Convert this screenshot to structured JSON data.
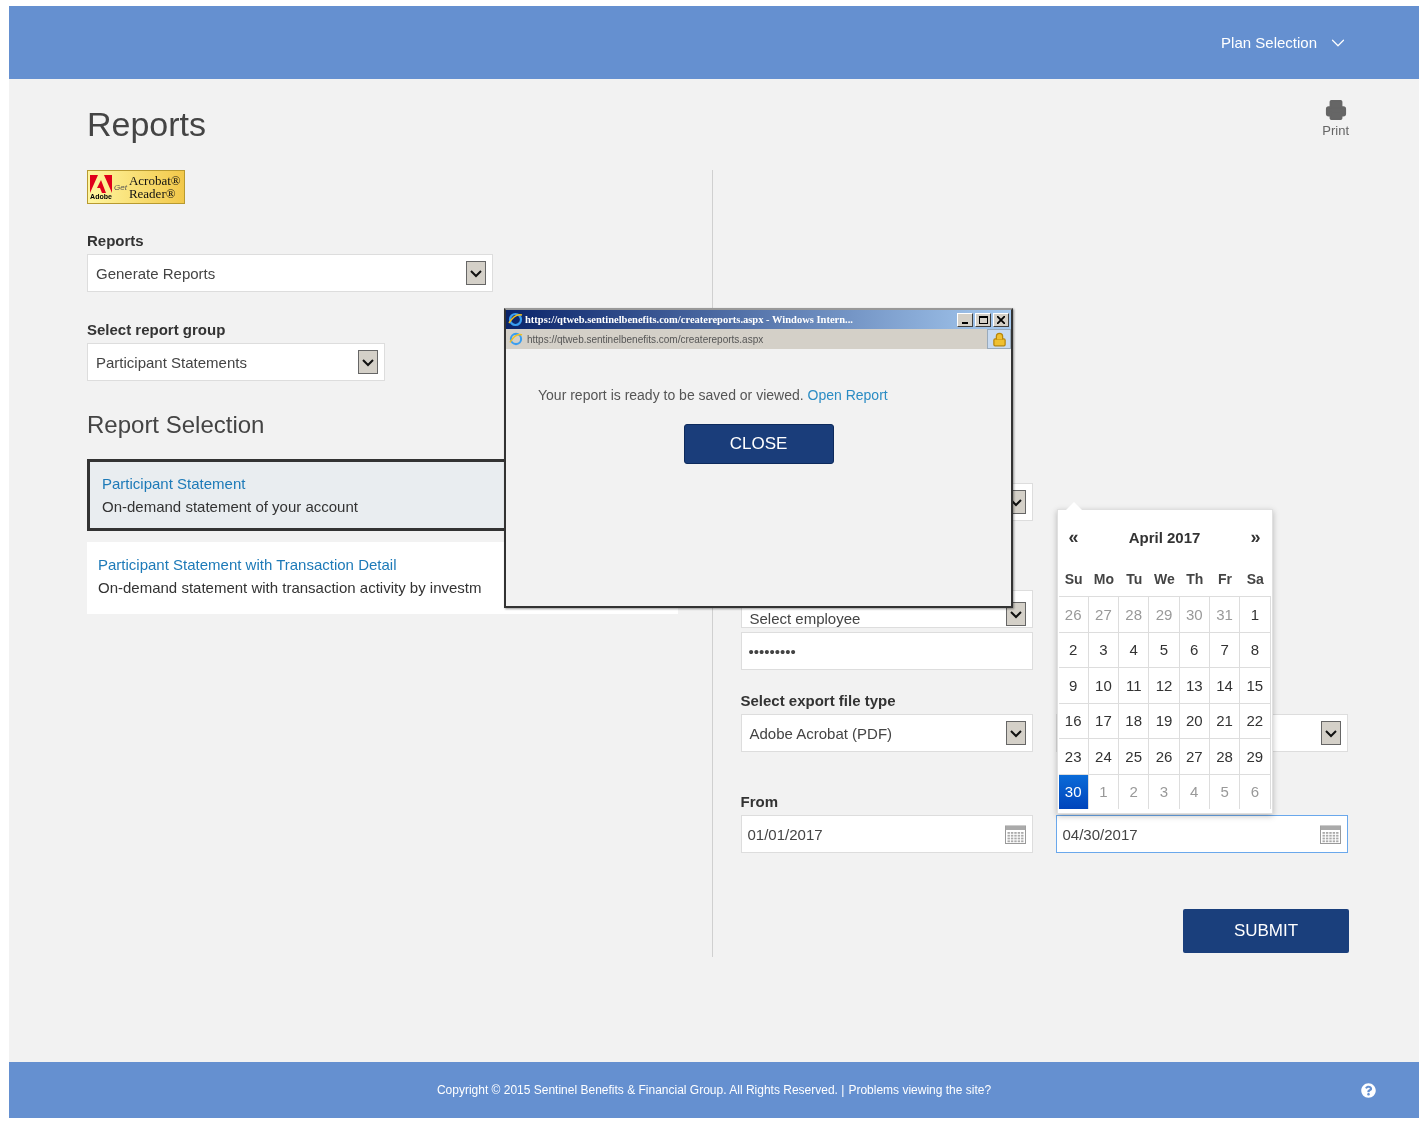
{
  "header": {
    "plan_selection": "Plan Selection"
  },
  "page": {
    "title": "Reports",
    "print_label": "Print"
  },
  "acrobat_badge": {
    "brand": "Adobe",
    "get": "Get",
    "line1": "Acrobat®",
    "line2": "Reader®"
  },
  "reports_field": {
    "label": "Reports",
    "value": "Generate Reports"
  },
  "report_group_field": {
    "label": "Select report group",
    "value": "Participant Statements"
  },
  "report_selection": {
    "heading": "Report Selection",
    "items": [
      {
        "title": "Participant Statement",
        "description": "On-demand statement of your account",
        "selected": true
      },
      {
        "title": "Participant Statement with Transaction Detail",
        "description": "On-demand statement with transaction activity by investm",
        "selected": false
      }
    ]
  },
  "right_form": {
    "employee_select": {
      "value": "Select employee"
    },
    "password": {
      "value": "•••••••••"
    },
    "export_type": {
      "label": "Select export file type",
      "value": "Adobe Acrobat (PDF)"
    },
    "from": {
      "label": "From",
      "value": "01/01/2017"
    },
    "to": {
      "value": "04/30/2017",
      "focused": true
    },
    "submit": "SUBMIT"
  },
  "datepicker": {
    "prev": "«",
    "month_label": "April 2017",
    "next": "»",
    "weekdays": [
      "Su",
      "Mo",
      "Tu",
      "We",
      "Th",
      "Fr",
      "Sa"
    ],
    "weeks": [
      [
        {
          "day": "26",
          "outside": true,
          "selected": false
        },
        {
          "day": "27",
          "outside": true,
          "selected": false
        },
        {
          "day": "28",
          "outside": true,
          "selected": false
        },
        {
          "day": "29",
          "outside": true,
          "selected": false
        },
        {
          "day": "30",
          "outside": true,
          "selected": false
        },
        {
          "day": "31",
          "outside": true,
          "selected": false
        },
        {
          "day": "1",
          "outside": false,
          "selected": false
        }
      ],
      [
        {
          "day": "2",
          "outside": false,
          "selected": false
        },
        {
          "day": "3",
          "outside": false,
          "selected": false
        },
        {
          "day": "4",
          "outside": false,
          "selected": false
        },
        {
          "day": "5",
          "outside": false,
          "selected": false
        },
        {
          "day": "6",
          "outside": false,
          "selected": false
        },
        {
          "day": "7",
          "outside": false,
          "selected": false
        },
        {
          "day": "8",
          "outside": false,
          "selected": false
        }
      ],
      [
        {
          "day": "9",
          "outside": false,
          "selected": false
        },
        {
          "day": "10",
          "outside": false,
          "selected": false
        },
        {
          "day": "11",
          "outside": false,
          "selected": false
        },
        {
          "day": "12",
          "outside": false,
          "selected": false
        },
        {
          "day": "13",
          "outside": false,
          "selected": false
        },
        {
          "day": "14",
          "outside": false,
          "selected": false
        },
        {
          "day": "15",
          "outside": false,
          "selected": false
        }
      ],
      [
        {
          "day": "16",
          "outside": false,
          "selected": false
        },
        {
          "day": "17",
          "outside": false,
          "selected": false
        },
        {
          "day": "18",
          "outside": false,
          "selected": false
        },
        {
          "day": "19",
          "outside": false,
          "selected": false
        },
        {
          "day": "20",
          "outside": false,
          "selected": false
        },
        {
          "day": "21",
          "outside": false,
          "selected": false
        },
        {
          "day": "22",
          "outside": false,
          "selected": false
        }
      ],
      [
        {
          "day": "23",
          "outside": false,
          "selected": false
        },
        {
          "day": "24",
          "outside": false,
          "selected": false
        },
        {
          "day": "25",
          "outside": false,
          "selected": false
        },
        {
          "day": "26",
          "outside": false,
          "selected": false
        },
        {
          "day": "27",
          "outside": false,
          "selected": false
        },
        {
          "day": "28",
          "outside": false,
          "selected": false
        },
        {
          "day": "29",
          "outside": false,
          "selected": false
        }
      ],
      [
        {
          "day": "30",
          "outside": false,
          "selected": true
        },
        {
          "day": "1",
          "outside": true,
          "selected": false
        },
        {
          "day": "2",
          "outside": true,
          "selected": false
        },
        {
          "day": "3",
          "outside": true,
          "selected": false
        },
        {
          "day": "4",
          "outside": true,
          "selected": false
        },
        {
          "day": "5",
          "outside": true,
          "selected": false
        },
        {
          "day": "6",
          "outside": true,
          "selected": false
        }
      ]
    ]
  },
  "popup": {
    "title": "https://qtweb.sentinelbenefits.com/createreports.aspx - Windows Intern...",
    "address": "https://qtweb.sentinelbenefits.com/createreports.aspx",
    "message": "Your report is ready to be saved or viewed.",
    "link": "Open Report",
    "close": "CLOSE"
  },
  "footer": {
    "copyright": "Copyright © 2015 Sentinel Benefits & Financial Group. All Rights Reserved. |",
    "link": "Problems viewing the site?"
  }
}
